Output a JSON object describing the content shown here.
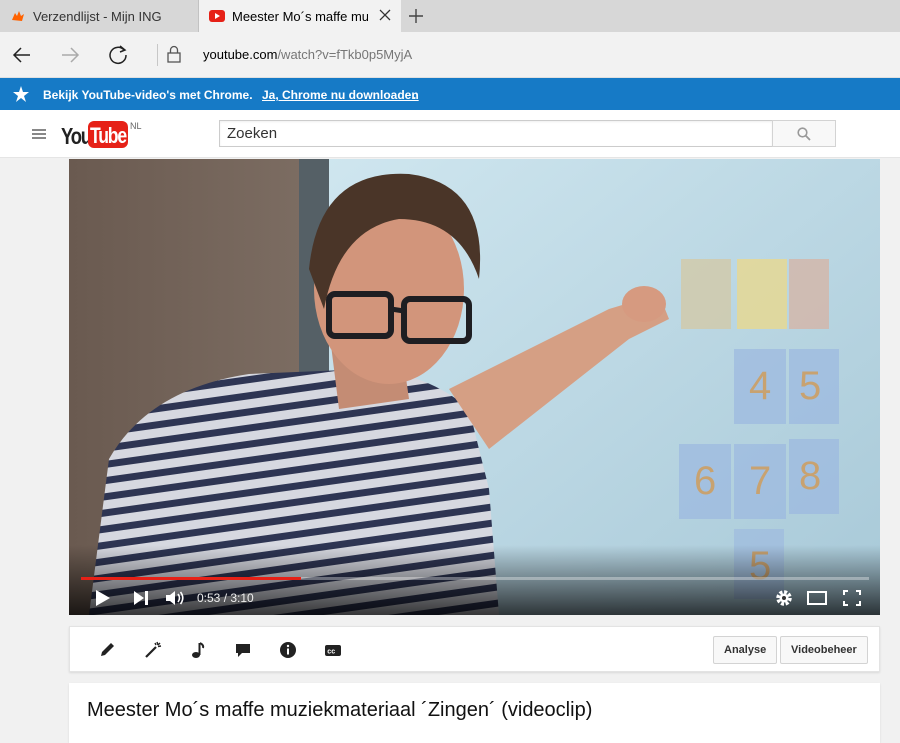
{
  "browser": {
    "tabs": [
      {
        "title": "Verzendlijst - Mijn ING",
        "active": false,
        "icon": "ing-lion-icon"
      },
      {
        "title": "Meester Mo´s maffe mu",
        "active": true,
        "icon": "youtube-icon"
      }
    ],
    "url_host": "youtube.com",
    "url_path": "/watch?v=fTkb0p5MyjA"
  },
  "promo": {
    "message": "Bekijk YouTube-video's met Chrome.",
    "link": "Ja, Chrome nu downloaden",
    "suffix": ".",
    "color": "#167ac6"
  },
  "masthead": {
    "logo_you": "You",
    "logo_tube": "Tube",
    "logo_region": "NL",
    "search_placeholder": "Zoeken"
  },
  "player": {
    "time": "0:53 / 3:10",
    "progress": 0.279,
    "progress_color": "#e62117"
  },
  "toolbar": {
    "tools": [
      "pencil-icon",
      "magic-wand-icon",
      "music-note-icon",
      "speech-bubble-icon",
      "info-icon",
      "cc-icon"
    ],
    "analytics_label": "Analyse",
    "video_manager_label": "Videobeheer"
  },
  "video": {
    "title": "Meester Mo´s maffe muziekmateriaal ´Zingen´ (videoclip)"
  }
}
